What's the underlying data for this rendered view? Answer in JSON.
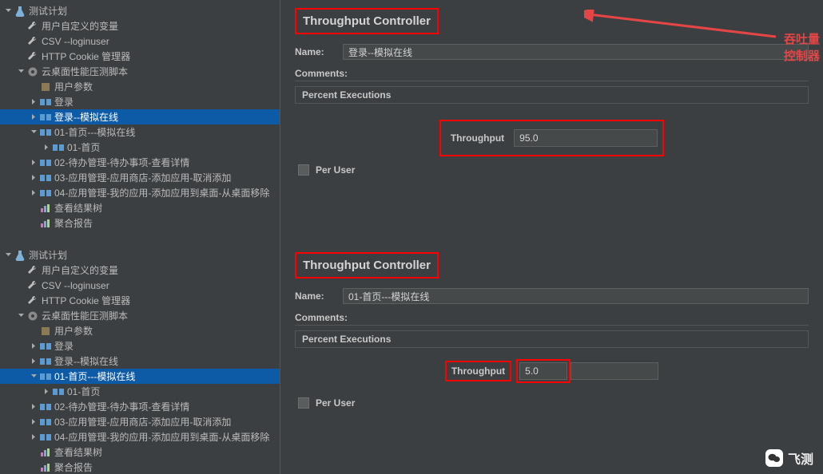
{
  "panels": [
    {
      "selected_index": 6,
      "tree": [
        {
          "indent": 0,
          "toggle": "down",
          "icon": "flask",
          "label": "测试计划"
        },
        {
          "indent": 1,
          "toggle": "none",
          "icon": "wrench",
          "label": "用户自定义的变量"
        },
        {
          "indent": 1,
          "toggle": "none",
          "icon": "wrench",
          "label": "CSV --loginuser"
        },
        {
          "indent": 1,
          "toggle": "none",
          "icon": "wrench",
          "label": "HTTP Cookie 管理器"
        },
        {
          "indent": 1,
          "toggle": "down",
          "icon": "gear",
          "label": "云桌面性能压测脚本"
        },
        {
          "indent": 2,
          "toggle": "none",
          "icon": "square",
          "label": "用户参数"
        },
        {
          "indent": 2,
          "toggle": "right",
          "icon": "loop",
          "label": "登录"
        },
        {
          "indent": 2,
          "toggle": "right",
          "icon": "loop",
          "label": "登录--模拟在线"
        },
        {
          "indent": 2,
          "toggle": "down",
          "icon": "loop",
          "label": "01-首页---模拟在线"
        },
        {
          "indent": 3,
          "toggle": "right",
          "icon": "loop",
          "label": "01-首页"
        },
        {
          "indent": 2,
          "toggle": "right",
          "icon": "loop",
          "label": "02-待办管理-待办事项-查看详情"
        },
        {
          "indent": 2,
          "toggle": "right",
          "icon": "loop",
          "label": "03-应用管理-应用商店-添加应用-取消添加"
        },
        {
          "indent": 2,
          "toggle": "right",
          "icon": "loop",
          "label": "04-应用管理-我的应用-添加应用到桌面-从桌面移除"
        },
        {
          "indent": 2,
          "toggle": "none",
          "icon": "chart",
          "label": "查看结果树"
        },
        {
          "indent": 2,
          "toggle": "none",
          "icon": "chart",
          "label": "聚合报告"
        }
      ],
      "editor": {
        "title": "Throughput Controller",
        "name_label": "Name:",
        "name_value": "登录--模拟在线",
        "comments_label": "Comments:",
        "percent_label": "Percent Executions",
        "throughput_label": "Throughput",
        "throughput_value": "95.0",
        "peruser_label": "Per User",
        "annotation": "吞吐量控制器",
        "annotation_color": "#e54545",
        "show_arrow": true,
        "big_throughput_box": true
      }
    },
    {
      "selected_index": 8,
      "tree": [
        {
          "indent": 0,
          "toggle": "down",
          "icon": "flask",
          "label": "测试计划"
        },
        {
          "indent": 1,
          "toggle": "none",
          "icon": "wrench",
          "label": "用户自定义的变量"
        },
        {
          "indent": 1,
          "toggle": "none",
          "icon": "wrench",
          "label": "CSV --loginuser"
        },
        {
          "indent": 1,
          "toggle": "none",
          "icon": "wrench",
          "label": "HTTP Cookie 管理器"
        },
        {
          "indent": 1,
          "toggle": "down",
          "icon": "gear",
          "label": "云桌面性能压测脚本"
        },
        {
          "indent": 2,
          "toggle": "none",
          "icon": "square",
          "label": "用户参数"
        },
        {
          "indent": 2,
          "toggle": "right",
          "icon": "loop",
          "label": "登录"
        },
        {
          "indent": 2,
          "toggle": "right",
          "icon": "loop",
          "label": "登录--模拟在线"
        },
        {
          "indent": 2,
          "toggle": "down",
          "icon": "loop",
          "label": "01-首页---模拟在线"
        },
        {
          "indent": 3,
          "toggle": "right",
          "icon": "loop",
          "label": "01-首页"
        },
        {
          "indent": 2,
          "toggle": "right",
          "icon": "loop",
          "label": "02-待办管理-待办事项-查看详情"
        },
        {
          "indent": 2,
          "toggle": "right",
          "icon": "loop",
          "label": "03-应用管理-应用商店-添加应用-取消添加"
        },
        {
          "indent": 2,
          "toggle": "right",
          "icon": "loop",
          "label": "04-应用管理-我的应用-添加应用到桌面-从桌面移除"
        },
        {
          "indent": 2,
          "toggle": "none",
          "icon": "chart",
          "label": "查看结果树"
        },
        {
          "indent": 2,
          "toggle": "none",
          "icon": "chart",
          "label": "聚合报告"
        }
      ],
      "editor": {
        "title": "Throughput Controller",
        "name_label": "Name:",
        "name_value": "01-首页---模拟在线",
        "comments_label": "Comments:",
        "percent_label": "Percent Executions",
        "throughput_label": "Throughput",
        "throughput_value": "5.0",
        "peruser_label": "Per User",
        "show_arrow": false,
        "big_throughput_box": false
      }
    }
  ],
  "watermark": {
    "text": "飞测"
  }
}
